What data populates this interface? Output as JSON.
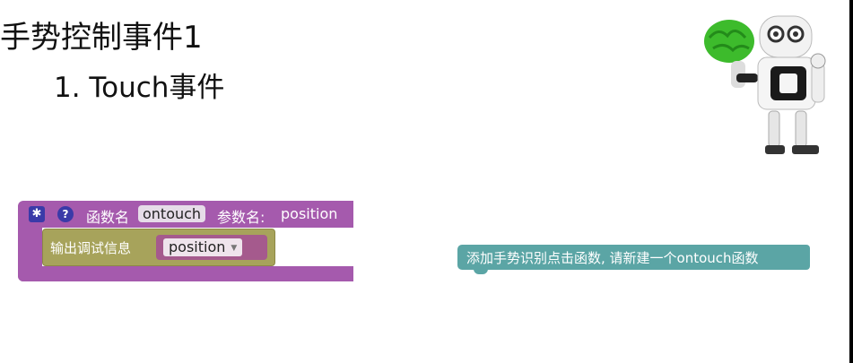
{
  "slide": {
    "title": "手势控制事件1",
    "subtitle": "1. Touch事件"
  },
  "function_block": {
    "settings_icon": "gear-icon",
    "help_icon": "question-icon",
    "help_glyph": "?",
    "label": "函数名",
    "name": "ontouch",
    "param_label": "参数名:",
    "param_value": "position",
    "color": "#a55aad"
  },
  "debug_block": {
    "label": "输出调试信息",
    "variable": "position",
    "color": "#a7a35b"
  },
  "gesture_block": {
    "label": "添加手势识别点击函数, 请新建一个ontouch函数",
    "color": "#5ba5a5"
  },
  "illustration": {
    "icon": "robot-holding-brain-icon"
  }
}
